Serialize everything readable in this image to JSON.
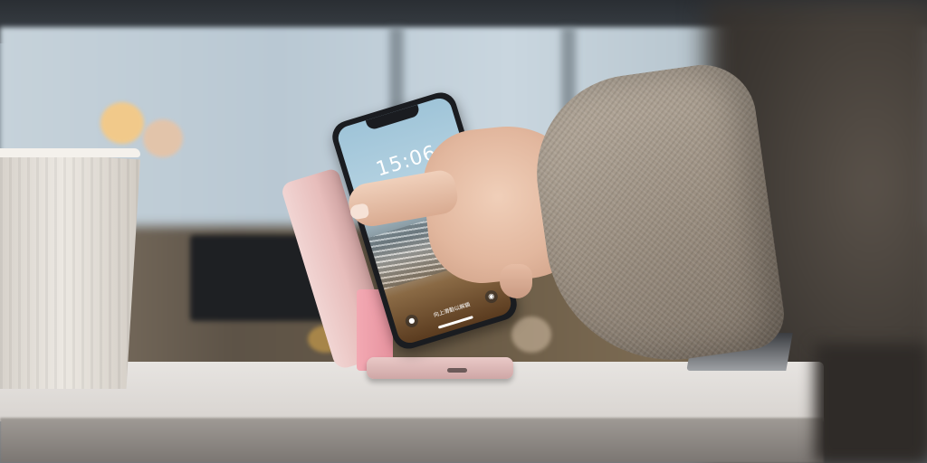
{
  "photo": {
    "description_hidden": "",
    "phone_screen": {
      "clock": "15:06",
      "unlock_hint": "向上滑動以解鎖"
    },
    "colors": {
      "stand_pink": "#e9c1bf",
      "sleeve_tweed": "#a89c8e",
      "table_white": "#e3e0dd",
      "window_blue": "#c0cfd9"
    }
  }
}
